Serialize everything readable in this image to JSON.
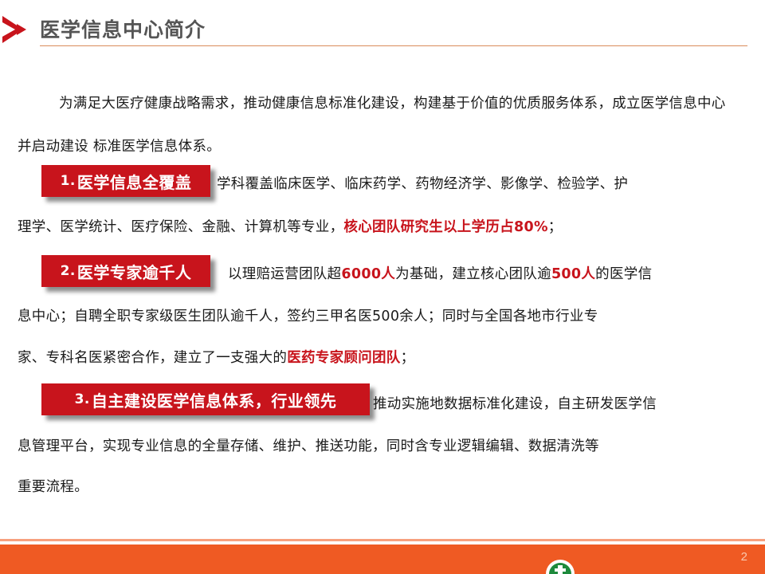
{
  "header": {
    "title": "医学信息中心简介"
  },
  "intro": "为满足大医疗健康战略需求，推动健康信息标准化建设，构建基于价值的优质服务体系，成立医学信息中心并启动建设 标准医学信息体系。",
  "sections": [
    {
      "badge_num": "1.",
      "badge_text": "医学信息全覆盖",
      "line1": "学科覆盖临床医学、临床药学、药物经济学、影像学、检验学、护",
      "line2_pre": "理学、医学统计、医疗保险、金融、计算机等专业，",
      "line2_hl": "核心团队研究生以上学历占80%",
      "line2_post": "；"
    },
    {
      "badge_num": "2.",
      "badge_text": "医学专家逾千人",
      "line1_pre": "以理赔运营团队超",
      "line1_hl1": "6000人",
      "line1_mid": "为基础，建立核心团队逾",
      "line1_hl2": "500人",
      "line1_post": "的医学信",
      "line2": "息中心；自聘全职专家级医生团队逾千人，签约三甲名医500余人；同时与全国各地市行业专",
      "line3_pre": "家、专科名医紧密合作，建立了一支强大的",
      "line3_hl": "医药专家顾问团队",
      "line3_post": "；"
    },
    {
      "badge_num": "3.",
      "badge_text": "自主建设医学信息体系，行业领先",
      "line1": "推动实施地数据标准化建设，自主研发医学信",
      "line2": "息管理平台，实现专业信息的全量存储、维护、推送功能，同时含专业逻辑编辑、数据清洗等",
      "line3": "重要流程。"
    }
  ],
  "footer": {
    "page_number": "2"
  },
  "colors": {
    "accent_red": "#c8141c",
    "footer_orange": "#ef5a23",
    "logo_green": "#1e8a3c"
  }
}
